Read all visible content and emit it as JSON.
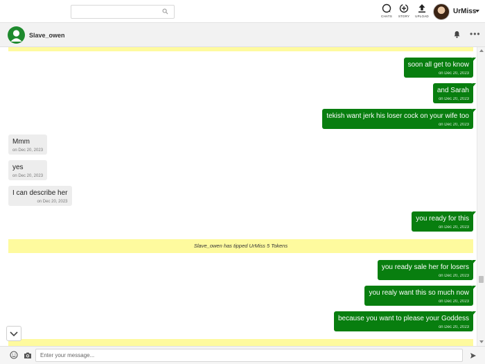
{
  "header": {
    "search": {
      "placeholder": "",
      "icon": "search-icon"
    },
    "nav": [
      {
        "label": "CHATS",
        "icon": "chat-bubble-icon"
      },
      {
        "label": "STORY",
        "icon": "story-icon"
      },
      {
        "label": "UPLOAD",
        "icon": "upload-icon"
      }
    ],
    "user": {
      "name": "UrMiss"
    }
  },
  "chat": {
    "contact_name": "Slave_owen",
    "accent_color": "#087e0f",
    "notice_color": "#fefa9e"
  },
  "messages": [
    {
      "direction": "out",
      "text": "soon all get to know",
      "time": "on Dec 20, 2023"
    },
    {
      "direction": "out",
      "text": "and Sarah",
      "time": "on Dec 20, 2023"
    },
    {
      "direction": "out",
      "text": "tekish want jerk his loser cock on your wife too",
      "time": "on Dec 20, 2023"
    },
    {
      "direction": "in",
      "text": "Mmm",
      "time": "on Dec 20, 2023"
    },
    {
      "direction": "in",
      "text": "yes",
      "time": "on Dec 20, 2023"
    },
    {
      "direction": "in",
      "text": "I can describe her",
      "time": "on Dec 20, 2023"
    },
    {
      "direction": "out",
      "text": "you ready for this",
      "time": "on Dec 20, 2023"
    },
    {
      "direction": "out",
      "text": "you ready sale her for losers",
      "time": "on Dec 20, 2023"
    },
    {
      "direction": "out",
      "text": "you realy want this so much now",
      "time": "on Dec 20, 2023"
    },
    {
      "direction": "out",
      "text": "because you want to please your Goddess",
      "time": "on Dec 20, 2023"
    }
  ],
  "notices": [
    {
      "text": ""
    },
    {
      "text": "Slave_owen has tipped UrMiss 5 Tokens"
    },
    {
      "text": ""
    }
  ],
  "composer": {
    "placeholder": "Enter your message..."
  }
}
